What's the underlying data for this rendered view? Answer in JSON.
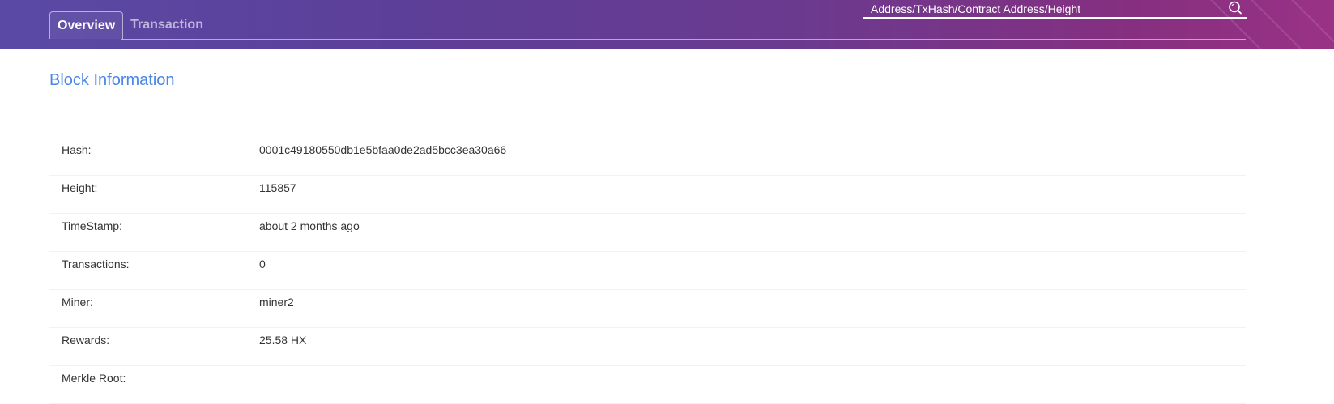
{
  "header": {
    "tabs": [
      {
        "label": "Overview",
        "active": true
      },
      {
        "label": "Transaction",
        "active": false
      }
    ],
    "search": {
      "placeholder": "Address/TxHash/Contract Address/Height",
      "icon": "search-icon"
    }
  },
  "block": {
    "title": "Block Information",
    "rows": [
      {
        "label": "Hash:",
        "value": "0001c49180550db1e5bfaa0de2ad5bcc3ea30a66"
      },
      {
        "label": "Height:",
        "value": "115857"
      },
      {
        "label": "TimeStamp:",
        "value": "about 2 months ago"
      },
      {
        "label": "Transactions:",
        "value": "0"
      },
      {
        "label": "Miner:",
        "value": "miner2"
      },
      {
        "label": "Rewards:",
        "value": "25.58 HX"
      },
      {
        "label": "Merkle Root:",
        "value": ""
      }
    ]
  },
  "colors": {
    "title_blue": "#4a86e8",
    "header_gradient_start": "#5a4aa6",
    "header_gradient_end": "#9a3285",
    "text": "#333333"
  }
}
